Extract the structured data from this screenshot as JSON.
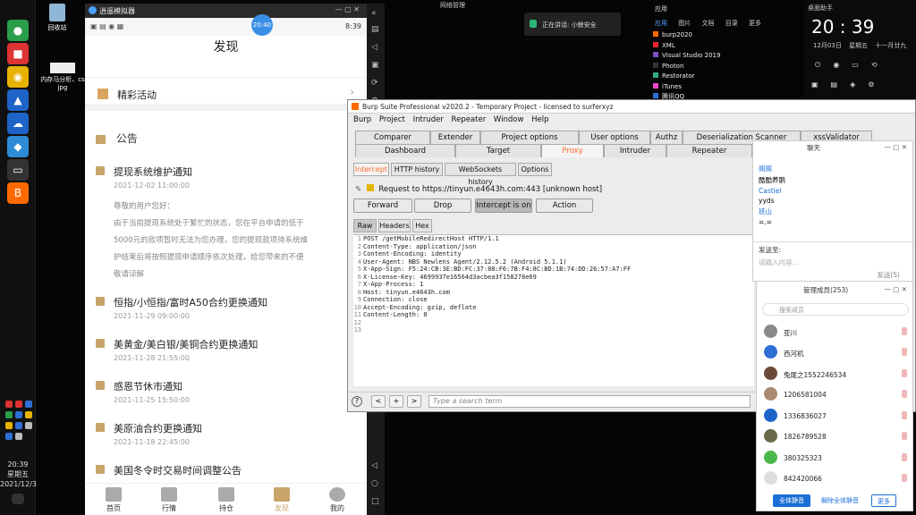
{
  "desktop": {
    "recycle_label": "回收站",
    "file_label_1": "内存马分析、cs",
    "file_label_2": "jpg"
  },
  "taskbar": {
    "time": "20:39",
    "weekday": "星期五",
    "date": "2021/12/3"
  },
  "phone": {
    "titlebar": "逍遥模拟器",
    "status_time": "8:39",
    "float_time": "20:40",
    "page_title": "发现",
    "activity_label": "精彩活动",
    "notice_heading": "公告",
    "notices": [
      {
        "title": "提现系统维护通知",
        "date": "2021-12-02 11:00:00"
      },
      {
        "title": "恒指/小恒指/富时A50合约更换通知",
        "date": "2021-11-29 09:00:00"
      },
      {
        "title": "美黄金/美白银/美铜合约更换通知",
        "date": "2021-11-28 21:55:00"
      },
      {
        "title": "感恩节休市通知",
        "date": "2021-11-25 15:50:00"
      },
      {
        "title": "美原油合约更换通知",
        "date": "2021-11-18 22:45:00"
      },
      {
        "title": "美国冬令时交易时间调整公告",
        "date": ""
      }
    ],
    "notice_body": [
      "尊敬的用户您好：",
      "由于当前提现系统处于繁忙的状态，您在平台申请的低于",
      "5000元的款项暂时无法为您办理，您的提现款项待系统维",
      "护结束后将按照提现申请顺序依次处理，给您带来的不便",
      "敬请谅解"
    ],
    "nav": [
      "首页",
      "行情",
      "持仓",
      "发现",
      "我的"
    ]
  },
  "top_right": {
    "app_items": [
      "burp2020",
      "XML",
      "Visual Studio 2019",
      "Photon",
      "Restorator",
      "iTunes",
      "腾讯QQ"
    ],
    "menu_tabs": [
      "应用",
      "图片",
      "文档",
      "目录",
      "更多"
    ],
    "talking": "正在讲话: 小鲸安全",
    "wifi_label": "网络管理",
    "assistant": "桌面助手",
    "clock_time": "20 : 39",
    "clock_date": "12月03日",
    "clock_weekday": "星期五",
    "clock_lunar": "十一月廿九"
  },
  "burp": {
    "title": "Burp Suite Professional v2020.2 - Temporary Project - licensed to surferxyz",
    "menu": [
      "Burp",
      "Project",
      "Intruder",
      "Repeater",
      "Window",
      "Help"
    ],
    "tabs_row1": [
      "Comparer",
      "Extender",
      "Project options",
      "User options",
      "Authz",
      "Deserialization Scanner",
      "xssValidator"
    ],
    "tabs_row2": [
      "Dashboard",
      "Target",
      "Proxy",
      "Intruder",
      "Repeater"
    ],
    "subtabs": [
      "Intercept",
      "HTTP history",
      "WebSockets history",
      "Options"
    ],
    "request_line": "Request to https://tinyun.e4643h.com:443  [unknown host]",
    "buttons": {
      "forward": "Forward",
      "drop": "Drop",
      "intercept": "Intercept is on",
      "action": "Action"
    },
    "view_tabs": [
      "Raw",
      "Headers",
      "Hex"
    ],
    "lines": [
      "POST /getMobileRedirectHost HTTP/1.1",
      "Content-Type: application/json",
      "Content-Encoding: identity",
      "User-Agent: NBS Newlens Agent/2.12.5.2 (Android 5.1.1)",
      "X-App-Sign: F5:24:CB:3E:BD:FC:37:88:F6:7B:F4:8C:BD:1B:74:DD:26:57:A7:FF",
      "X-License-Key: 4699937e16564d3acbea3f158278e69",
      "X-App-Process: 1",
      "Host: tinyun.e4643h.com",
      "Connection: close",
      "Accept-Encoding: gzip, deflate",
      "Content-Length: 0",
      "",
      ""
    ],
    "search_placeholder": "Type a search term",
    "help": "?"
  },
  "chat": {
    "title": "聊天",
    "messages": [
      {
        "text": "阁阁",
        "blue": true
      },
      {
        "text": "酷酷养鹅",
        "blue": false
      },
      {
        "text": "Castiel",
        "blue": true
      },
      {
        "text": "yyds",
        "blue": false
      },
      {
        "text": "班山",
        "blue": true
      },
      {
        "text": "=.=",
        "blue": false
      }
    ],
    "send_to": "发送至:",
    "input_placeholder": "请输入内容...",
    "send": "发送(S)"
  },
  "members": {
    "title": "管理成员(253)",
    "search": "搜索成员",
    "list": [
      "亚川",
      "西河机",
      "兔尾之1552246534",
      "1206581004",
      "1336836027",
      "1826789528",
      "380325323",
      "842420066"
    ],
    "btn_mute": "全体静音",
    "btn_unmute": "解除全体静音",
    "btn_more": "更多"
  },
  "colors": {
    "accent": "#ff6a2b",
    "chat_blue": "#1a6fd6",
    "notice_gold": "#c8a46a"
  }
}
